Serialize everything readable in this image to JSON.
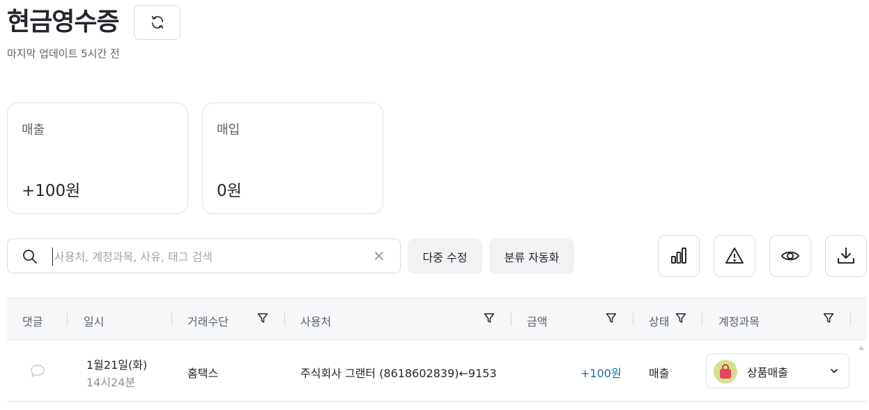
{
  "page": {
    "title": "현금영수증",
    "updated": "마지막 업데이트 5시간 전"
  },
  "summary": {
    "sales": {
      "label": "매출",
      "value": "+100원"
    },
    "purchase": {
      "label": "매입",
      "value": "0원"
    }
  },
  "toolbar": {
    "search_placeholder": "사용처, 계정과목, 사유, 태그 검색",
    "search_value": "",
    "multi_edit_label": "다중 수정",
    "auto_classify_label": "분류 자동화",
    "icons": [
      "bar-chart-icon",
      "warning-icon",
      "eye-icon",
      "download-icon"
    ]
  },
  "table": {
    "columns": [
      "댓글",
      "일시",
      "거래수단",
      "사용처",
      "금액",
      "상태",
      "계정과목"
    ],
    "rows": [
      {
        "date": "1월21일(화)",
        "time": "14시24분",
        "method": "홈택스",
        "merchant": "주식회사 그랜터 (8618602839)←9153",
        "amount": "+100원",
        "status": "매출",
        "account": "상품매출"
      }
    ]
  },
  "colors": {
    "amount_positive": "#1a6ea8",
    "account_avatar_bg": "#d6df8e",
    "account_icon": "#e9455a"
  }
}
